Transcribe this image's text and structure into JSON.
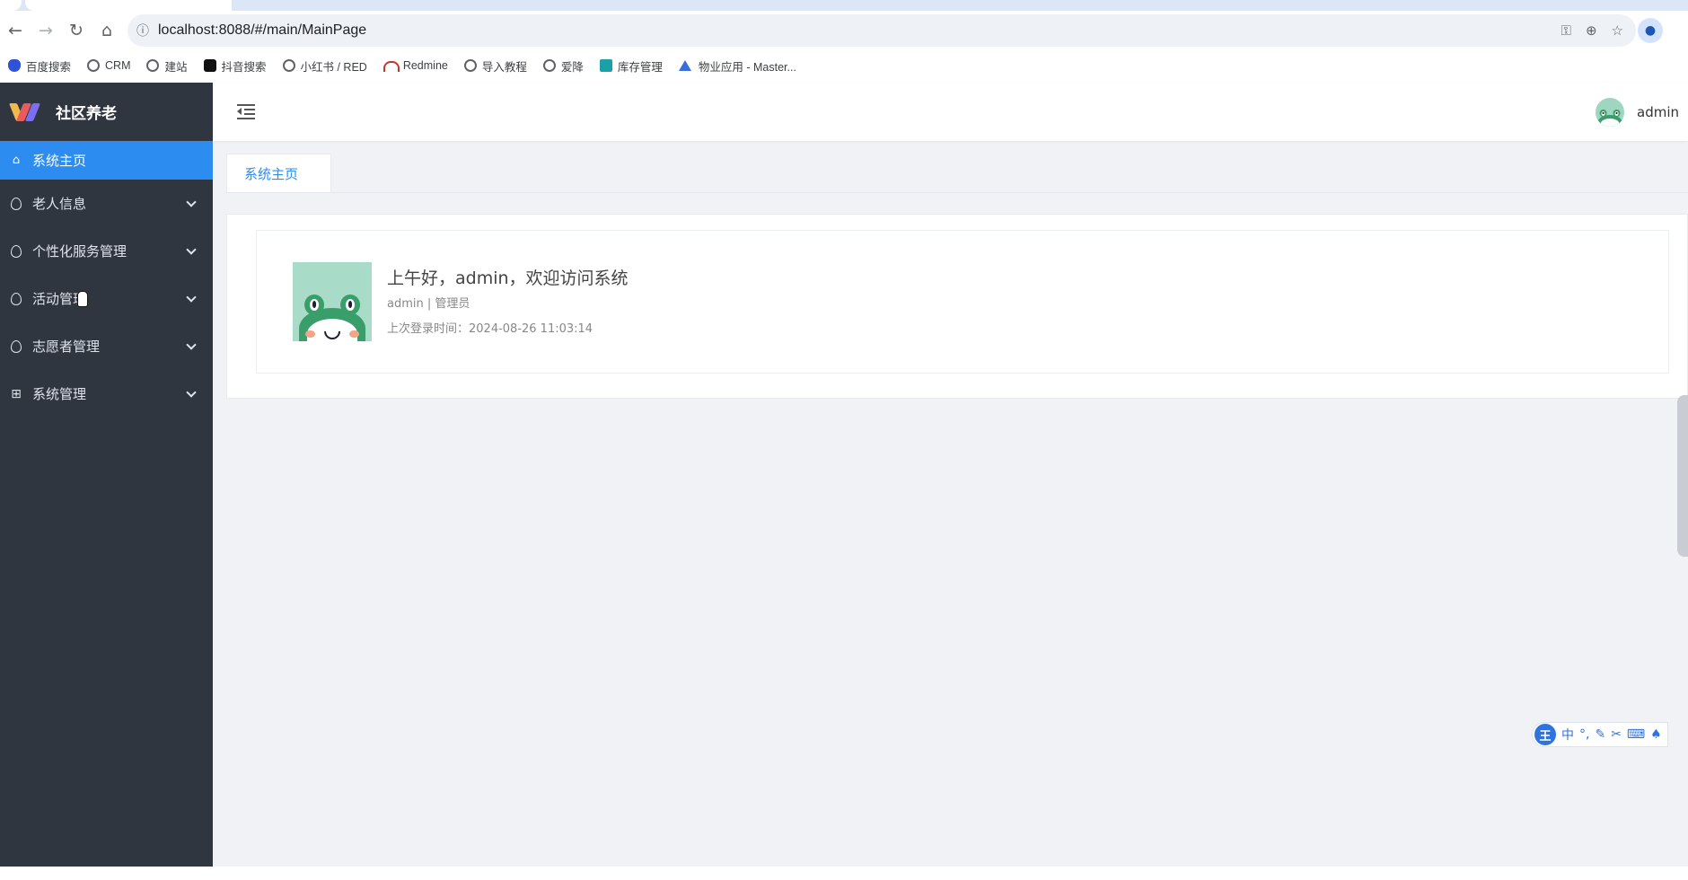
{
  "browser": {
    "url": "localhost:8088/#/main/MainPage",
    "bookmarks": [
      {
        "label": "百度搜索",
        "icon": "baidu-icon"
      },
      {
        "label": "CRM",
        "icon": "globe-icon"
      },
      {
        "label": "建站",
        "icon": "globe-icon"
      },
      {
        "label": "抖音搜索",
        "icon": "tiktok-icon"
      },
      {
        "label": "小红书 / RED",
        "icon": "globe-icon"
      },
      {
        "label": "Redmine",
        "icon": "redmine-icon"
      },
      {
        "label": "导入教程",
        "icon": "globe-icon"
      },
      {
        "label": "爱降",
        "icon": "globe-icon"
      },
      {
        "label": "库存管理",
        "icon": "app-icon"
      },
      {
        "label": "物业应用 - Master...",
        "icon": "triangle-icon"
      }
    ]
  },
  "sidebar": {
    "app_title": "社区养老",
    "items": [
      {
        "label": "系统主页",
        "icon": "home-icon",
        "active": true
      },
      {
        "label": "老人信息",
        "icon": "drop-icon"
      },
      {
        "label": "个性化服务管理",
        "icon": "drop-icon"
      },
      {
        "label": "活动管理",
        "icon": "drop-icon"
      },
      {
        "label": "志愿者管理",
        "icon": "drop-icon"
      },
      {
        "label": "系统管理",
        "icon": "grid-icon"
      }
    ]
  },
  "header": {
    "username": "admin"
  },
  "tabs": [
    {
      "label": "系统主页"
    }
  ],
  "welcome": {
    "greeting": "上午好，admin，欢迎访问系统",
    "role_line": "admin | 管理员",
    "last_login": "上次登录时间：2024-08-26 11:03:14"
  },
  "ime": {
    "badge": "王",
    "mode": "中",
    "punct": "°,"
  },
  "colors": {
    "sidebar_bg": "#303640",
    "accent": "#2d8cf0"
  }
}
